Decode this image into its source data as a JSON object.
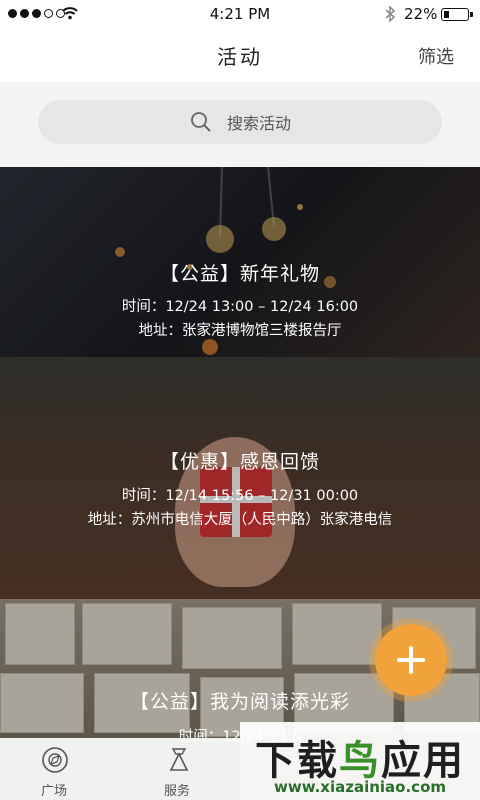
{
  "status_bar": {
    "time": "4:21 PM",
    "battery_percent": "22%",
    "battery_level": 0.22,
    "signal_dots": 5,
    "signal_filled": 3
  },
  "nav": {
    "title": "活动",
    "action": "筛选"
  },
  "search": {
    "placeholder": "搜索活动"
  },
  "events": [
    {
      "title": "【公益】新年礼物",
      "time": "时间：12/24 13:00 – 12/24 16:00",
      "address": "地址：张家港博物馆三楼报告厅"
    },
    {
      "title": "【优惠】感恩回馈",
      "time": "时间：12/14 15:56 – 12/31 00:00",
      "address": "地址：苏州市电信大厦（人民中路）张家港电信"
    },
    {
      "title": "【公益】我为阅读添光彩",
      "time": "时间：12/24 13:0",
      "address": ""
    }
  ],
  "tabs": [
    {
      "label": "广场",
      "icon": "compass-icon"
    },
    {
      "label": "服务",
      "icon": "bowtie-icon"
    }
  ],
  "watermark": {
    "main_left": "下载",
    "main_right": "应用",
    "main_middle": "鸟",
    "sub": "www.xiazainiao.com"
  },
  "colors": {
    "accent": "#f2a23a",
    "watermark_green": "#2a6e2a"
  }
}
